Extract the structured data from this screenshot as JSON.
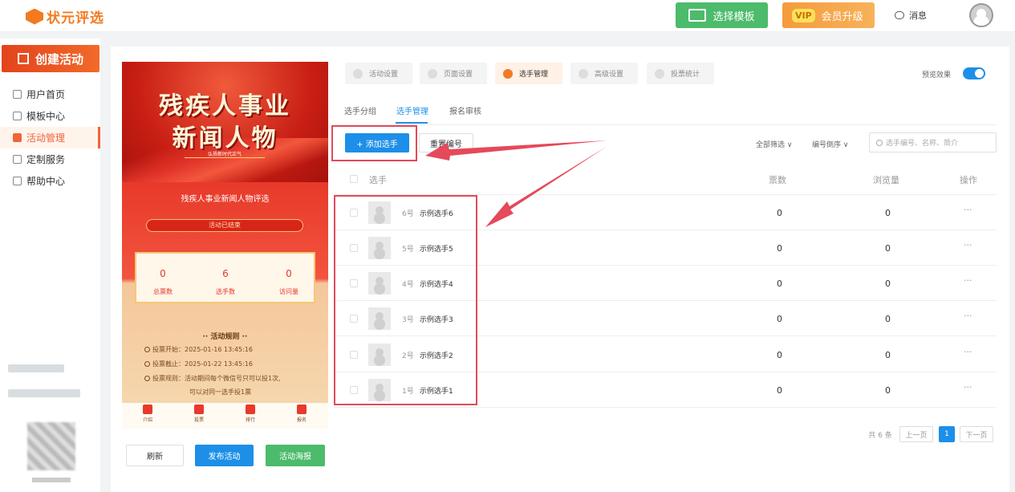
{
  "brand": {
    "name": "状元评选"
  },
  "header": {
    "template_btn": "选择模板",
    "vip_badge": "VIP",
    "vip_btn": "会员升级",
    "messages": "消息"
  },
  "sidebar": {
    "create": "创建活动",
    "items": [
      {
        "label": "用户首页"
      },
      {
        "label": "模板中心"
      },
      {
        "label": "活动管理"
      },
      {
        "label": "定制服务"
      },
      {
        "label": "帮助中心"
      }
    ]
  },
  "preview": {
    "poster_title_1": "残疾人事业",
    "poster_title_2": "新闻人物",
    "poster_sub": "弘扬新时代正气",
    "title": "残疾人事业新闻人物评选",
    "status": "活动已结束",
    "stats": [
      {
        "value": "0",
        "label": "总票数"
      },
      {
        "value": "6",
        "label": "选手数"
      },
      {
        "value": "0",
        "label": "访问量"
      }
    ],
    "rules_title": "活动规则",
    "rules": [
      "投票开始：2025-01-16 13:45:16",
      "投票截止：2025-01-22 13:45:16",
      "投票规则：活动期间每个微信号只可以投1次,",
      "可以对同一选手投1票"
    ],
    "tabs": [
      "介绍",
      "投票",
      "排行",
      "报名"
    ]
  },
  "actions": {
    "refresh": "刷新",
    "publish": "发布活动",
    "poster": "活动海报"
  },
  "settings_tabs": [
    "活动设置",
    "页面设置",
    "选手管理",
    "高级设置",
    "投票统计"
  ],
  "preview_toggle_label": "预览效果",
  "subtabs": [
    "选手分组",
    "选手管理",
    "报名审核"
  ],
  "toolbar": {
    "add": "+ 添加选手",
    "renumber": "重置编号",
    "filter_all": "全部筛选 ∨",
    "sort": "编号倒序 ∨",
    "search_placeholder": "选手编号、名称、简介"
  },
  "table": {
    "headers": {
      "player": "选手",
      "votes": "票数",
      "views": "浏览量",
      "ops": "操作"
    },
    "rows": [
      {
        "no": "6号",
        "name": "示例选手6",
        "votes": "0",
        "views": "0",
        "ops": "···"
      },
      {
        "no": "5号",
        "name": "示例选手5",
        "votes": "0",
        "views": "0",
        "ops": "···"
      },
      {
        "no": "4号",
        "name": "示例选手4",
        "votes": "0",
        "views": "0",
        "ops": "···"
      },
      {
        "no": "3号",
        "name": "示例选手3",
        "votes": "0",
        "views": "0",
        "ops": "···"
      },
      {
        "no": "2号",
        "name": "示例选手2",
        "votes": "0",
        "views": "0",
        "ops": "···"
      },
      {
        "no": "1号",
        "name": "示例选手1",
        "votes": "0",
        "views": "0",
        "ops": "···"
      }
    ]
  },
  "pagination": {
    "total": "共 6 条",
    "prev": "上一页",
    "current": "1",
    "next": "下一页"
  },
  "colors": {
    "brand": "#f47a20",
    "primary": "#1d8fe8",
    "green": "#4cbb6b",
    "annotation": "#e5495a"
  }
}
